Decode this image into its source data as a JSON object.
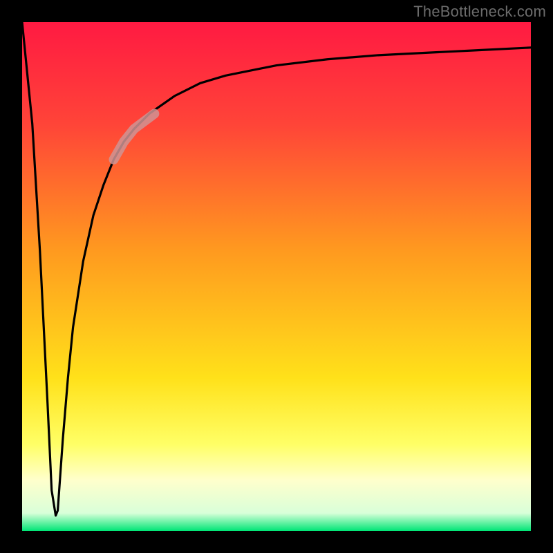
{
  "attribution": "TheBottleneck.com",
  "colors": {
    "frame": "#000000",
    "attribution_text": "#6b6b6b",
    "curve": "#000000",
    "highlight": "#cf9494",
    "gradient_stops": [
      {
        "offset": 0.0,
        "color": "#ff1a42"
      },
      {
        "offset": 0.2,
        "color": "#ff4438"
      },
      {
        "offset": 0.45,
        "color": "#ff9a1f"
      },
      {
        "offset": 0.7,
        "color": "#ffe11a"
      },
      {
        "offset": 0.83,
        "color": "#ffff66"
      },
      {
        "offset": 0.9,
        "color": "#ffffcc"
      },
      {
        "offset": 0.965,
        "color": "#d9ffd9"
      },
      {
        "offset": 1.0,
        "color": "#00e676"
      }
    ]
  },
  "chart_data": {
    "type": "line",
    "title": "",
    "xlabel": "",
    "ylabel": "",
    "xlim": [
      0,
      100
    ],
    "ylim": [
      0,
      100
    ],
    "grid": false,
    "legend": false,
    "annotations": [
      "TheBottleneck.com"
    ],
    "series": [
      {
        "name": "bottleneck-curve",
        "x": [
          0,
          2,
          3.5,
          5,
          5.8,
          6.6,
          7,
          8,
          9,
          10,
          12,
          14,
          16,
          18,
          20,
          22,
          25,
          30,
          35,
          40,
          50,
          60,
          70,
          80,
          90,
          100
        ],
        "values": [
          100,
          80,
          55,
          25,
          8,
          3,
          4,
          18,
          30,
          40,
          53,
          62,
          68,
          73,
          76.5,
          79,
          82,
          85.5,
          88,
          89.5,
          91.5,
          92.7,
          93.5,
          94,
          94.5,
          95
        ]
      },
      {
        "name": "highlight-segment",
        "x": [
          18,
          20,
          22,
          24,
          26
        ],
        "values": [
          73,
          76.5,
          79,
          80.5,
          82
        ]
      }
    ]
  }
}
